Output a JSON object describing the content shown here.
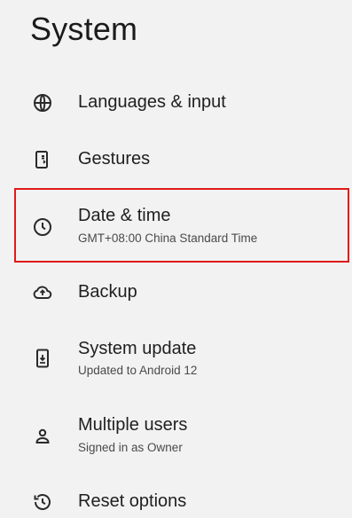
{
  "header": {
    "title": "System"
  },
  "items": [
    {
      "label": "Languages & input",
      "subtitle": "",
      "icon": "globe-icon"
    },
    {
      "label": "Gestures",
      "subtitle": "",
      "icon": "gestures-phone-icon"
    },
    {
      "label": "Date & time",
      "subtitle": "GMT+08:00 China Standard Time",
      "icon": "clock-icon"
    },
    {
      "label": "Backup",
      "subtitle": "",
      "icon": "cloud-upload-icon"
    },
    {
      "label": "System update",
      "subtitle": "Updated to Android 12",
      "icon": "system-update-icon"
    },
    {
      "label": "Multiple users",
      "subtitle": "Signed in as Owner",
      "icon": "person-icon"
    },
    {
      "label": "Reset options",
      "subtitle": "",
      "icon": "history-icon"
    }
  ],
  "colors": {
    "background": "#f2f2f3",
    "highlight": "#e01a1a",
    "text": "#1f1f1f"
  }
}
